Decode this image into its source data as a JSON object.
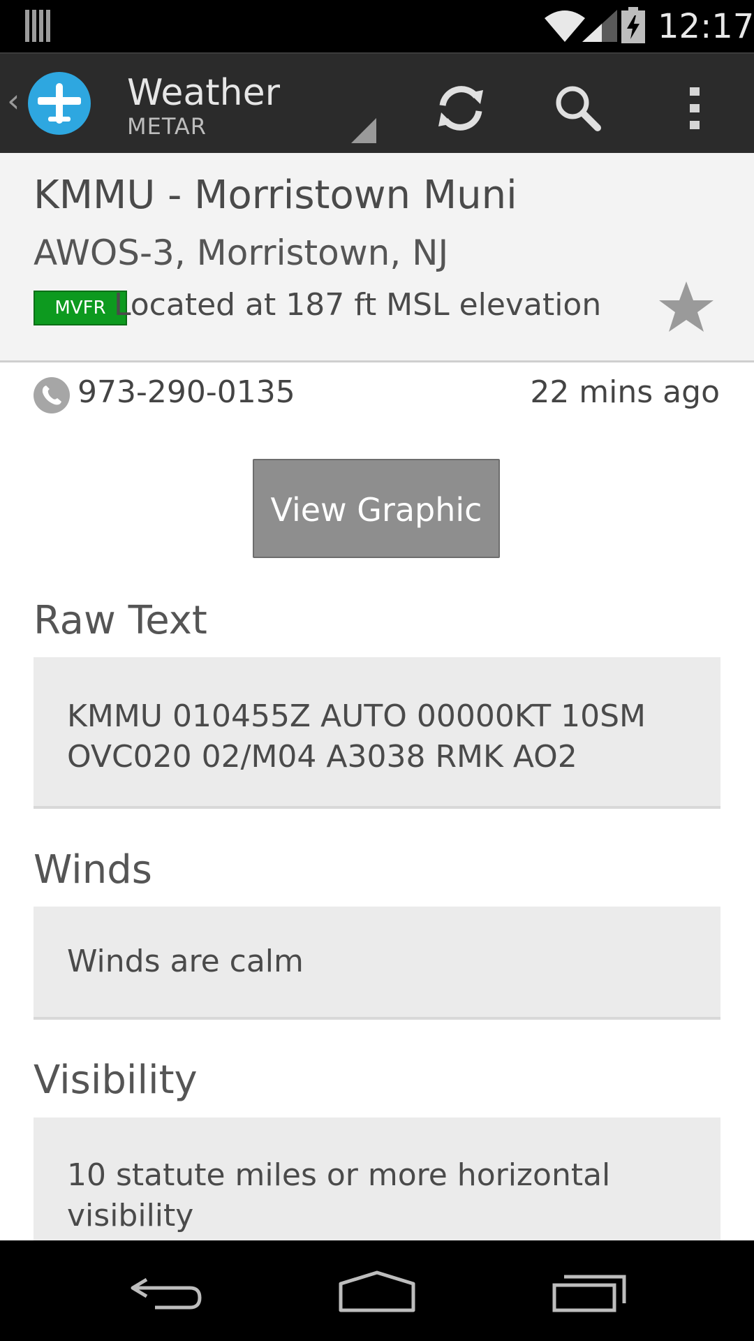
{
  "status_bar": {
    "time": "12:17"
  },
  "action_bar": {
    "title": "Weather",
    "subtitle": "METAR",
    "icons": [
      "up-caret-icon",
      "airplane-icon",
      "refresh-icon",
      "search-icon",
      "overflow-menu-icon"
    ],
    "accent_color": "#2ea7e0"
  },
  "station": {
    "name": "KMMU - Morristown Muni",
    "source": "AWOS-3, Morristown, NJ",
    "flight_category": "MVFR",
    "flight_category_color": "#0d9a1f",
    "elevation_text": "Located at 187 ft MSL elevation",
    "favorite_icon": "star-icon"
  },
  "info": {
    "phone": "973-290-0135",
    "age": "22 mins ago"
  },
  "actions": {
    "view_graphic_label": "View Graphic"
  },
  "sections": {
    "raw_text": {
      "title": "Raw Text",
      "line1": "KMMU 010455Z AUTO 00000KT 10SM",
      "line2": "OVC020 02/M04 A3038 RMK AO2"
    },
    "winds": {
      "title": "Winds",
      "body": "Winds are calm"
    },
    "visibility": {
      "title": "Visibility",
      "line1": "10 statute miles or more horizontal",
      "line2": "visibility"
    }
  },
  "nav_bar": {
    "icons": [
      "back-icon",
      "home-icon",
      "recent-apps-icon"
    ]
  }
}
